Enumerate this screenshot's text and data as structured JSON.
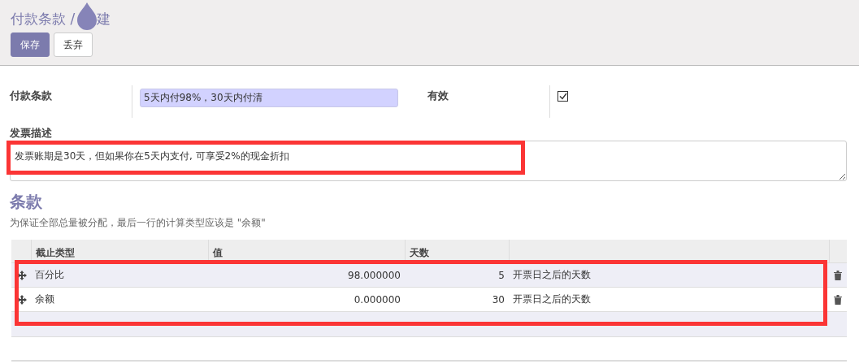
{
  "breadcrumb": {
    "parent": "付款条款 /",
    "current": "建"
  },
  "buttons": [
    {
      "label": "保存",
      "kind": "primary"
    },
    {
      "label": "丢弃",
      "kind": "secondary"
    }
  ],
  "form": {
    "name_label": "付款条款",
    "name_value": "5天内付98%，30天内付清",
    "active_label": "有效",
    "active_checked": true,
    "note_label": "发票描述",
    "note_value": "发票账期是30天，但如果你在5天内支付, 可享受2%的现金折扣"
  },
  "terms": {
    "title": "条款",
    "hint": "为保证全部总量被分配，最后一行的计算类型应该是 \"余额\"",
    "columns": [
      "截止类型",
      "值",
      "天数"
    ],
    "rows": [
      {
        "type": "百分比",
        "value": "98.000000",
        "days": "5",
        "option": "开票日之后的天数"
      },
      {
        "type": "余额",
        "value": "0.000000",
        "days": "30",
        "option": "开票日之后的天数"
      }
    ]
  }
}
